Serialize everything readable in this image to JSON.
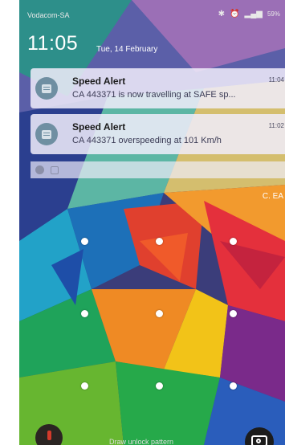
{
  "status_bar": {
    "carrier": "Vodacom-SA",
    "battery": "59%"
  },
  "lock_screen": {
    "time": "11:05",
    "date": "Tue, 14 February"
  },
  "notifications": [
    {
      "title": "Speed Alert",
      "text": "CA 443371 is now travelling at SAFE sp...",
      "time": "11:04"
    },
    {
      "title": "Speed Alert",
      "text": "CA 443371 overspeeding at 101 Km/h",
      "time": "11:02"
    }
  ],
  "side_text": "C. EA",
  "unlock_hint": "Draw unlock pattern",
  "colors": {
    "notification_bg": "#f0ecfa",
    "icon_bg": "#6f8fa2"
  }
}
